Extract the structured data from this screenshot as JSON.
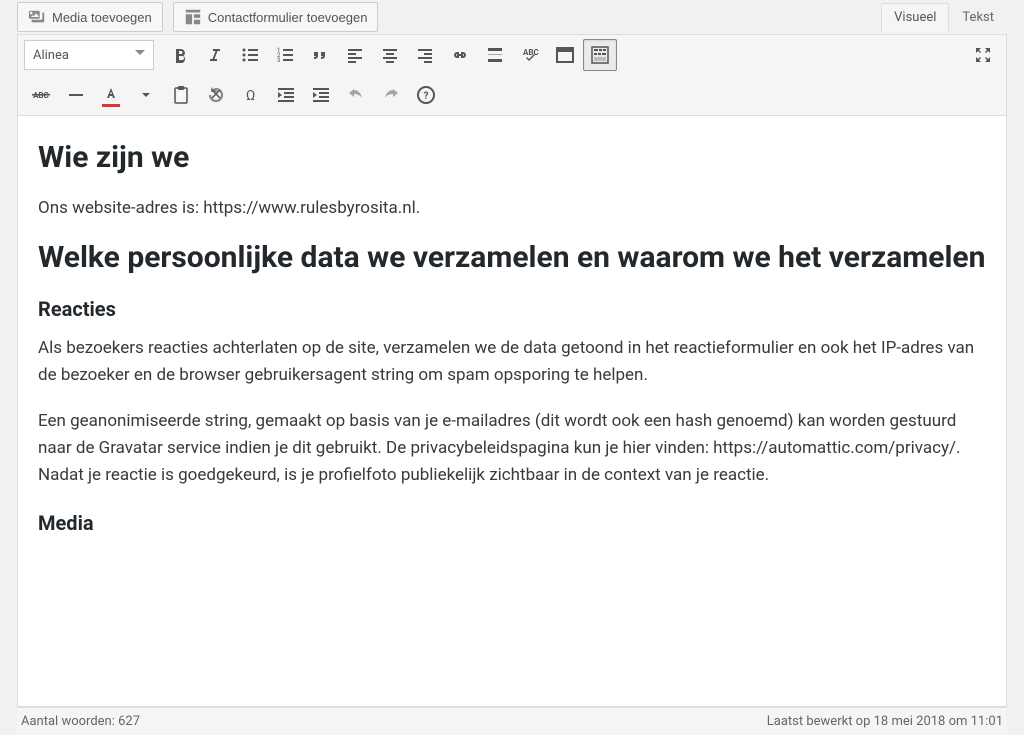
{
  "topBar": {
    "addMedia": "Media toevoegen",
    "addContactForm": "Contactformulier toevoegen"
  },
  "tabs": {
    "visual": "Visueel",
    "text": "Tekst"
  },
  "toolbar": {
    "formatSelect": "Alinea"
  },
  "content": {
    "h2_1": "Wie zijn we",
    "p_1": "Ons website-adres is: https://www.rulesbyrosita.nl.",
    "h2_2": "Welke persoonlijke data we verzamelen en waarom we het verzamelen",
    "h3_1": "Reacties",
    "p_2": "Als bezoekers reacties achterlaten op de site, verzamelen we de data getoond in het reactieformulier en ook het IP-adres van de bezoeker en de browser gebruikersagent string om spam opsporing te helpen.",
    "p_3": "Een geanonimiseerde string, gemaakt op basis van je e-mailadres (dit wordt ook een hash genoemd) kan worden gestuurd naar de Gravatar service indien je dit gebruikt. De privacybeleidspagina kun je hier vinden: https://automattic.com/privacy/. Nadat je reactie is goedgekeurd, is je profielfoto publiekelijk zichtbaar in de context van je reactie.",
    "h3_2": "Media"
  },
  "status": {
    "wordCount": "Aantal woorden: 627",
    "lastEdited": "Laatst bewerkt op 18 mei 2018 om 11:01"
  }
}
